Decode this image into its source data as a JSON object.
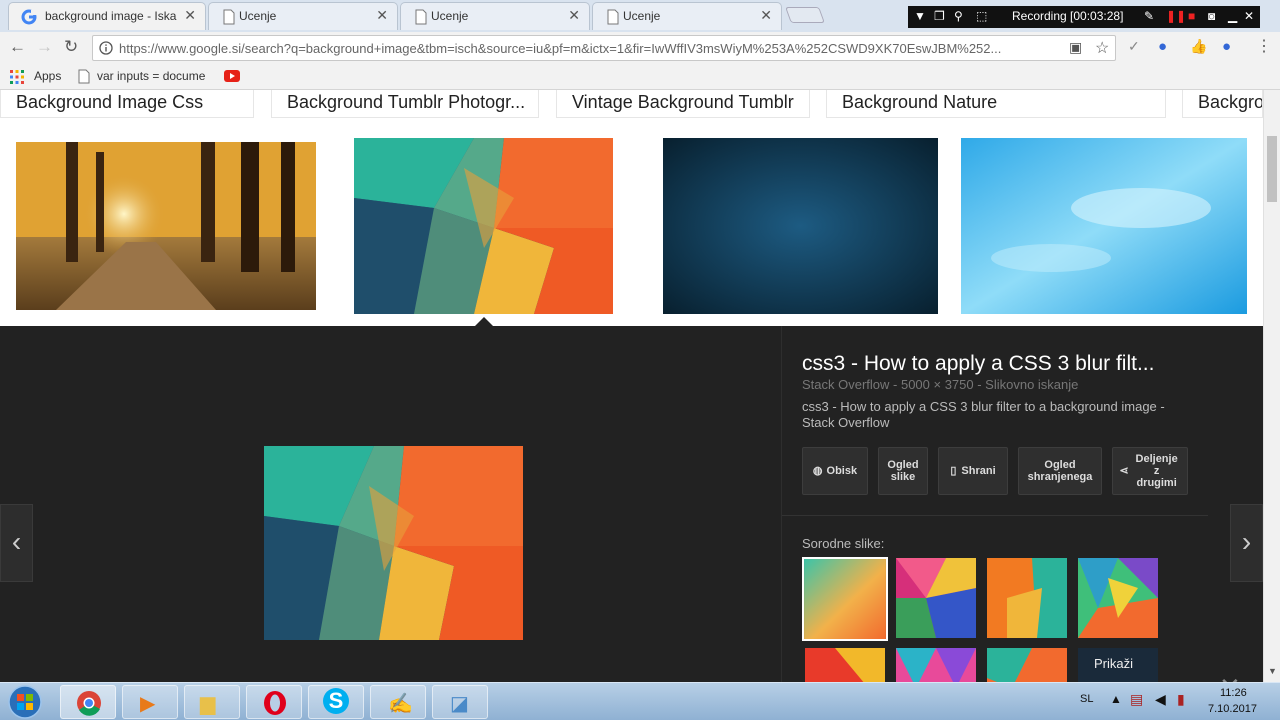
{
  "browser": {
    "tabs": [
      {
        "title": "background image - Iska",
        "active": true,
        "favicon": "google-g-icon"
      },
      {
        "title": "Ucenje",
        "active": false,
        "favicon": "page-icon"
      },
      {
        "title": "Ucenje",
        "active": false,
        "favicon": "page-icon"
      },
      {
        "title": "Ucenje",
        "active": false,
        "favicon": "page-icon"
      }
    ],
    "recording_label": "Recording [00:03:28]",
    "url": "https://www.google.si/search?q=background+image&tbm=isch&source=iu&pf=m&ictx=1&fir=IwWffIV3msWiyM%253A%252CSWD9XK70EswJBM%252...",
    "bookmarks": {
      "apps_label": "Apps",
      "item1": "var inputs = docume"
    }
  },
  "page": {
    "related_searches": [
      "Background Image Css",
      "Background Tumblr Photogr...",
      "Vintage Background Tumblr",
      "Background Nature",
      "Backgro"
    ],
    "preview": {
      "title": "css3 - How to apply a CSS 3 blur filt...",
      "meta": "Stack Overflow - 5000 × 3750 - Slikovno iskanje",
      "description": "css3 - How to apply a CSS 3 blur filter to a background image - Stack Overflow",
      "buttons": {
        "visit": "Obisk",
        "view_image": "Ogled slike",
        "save": "Shrani",
        "view_saved": "Ogled shranjenega",
        "share": "Deljenje z drugimi"
      },
      "related_label": "Sorodne slike:",
      "show_more": "Prikaži"
    }
  },
  "taskbar": {
    "language": "SL",
    "time": "11:26",
    "date": "7.10.2017"
  },
  "colors": {
    "accent_blue": "#1a73e8",
    "preview_bg": "#222222",
    "recording_bg": "#111111"
  }
}
